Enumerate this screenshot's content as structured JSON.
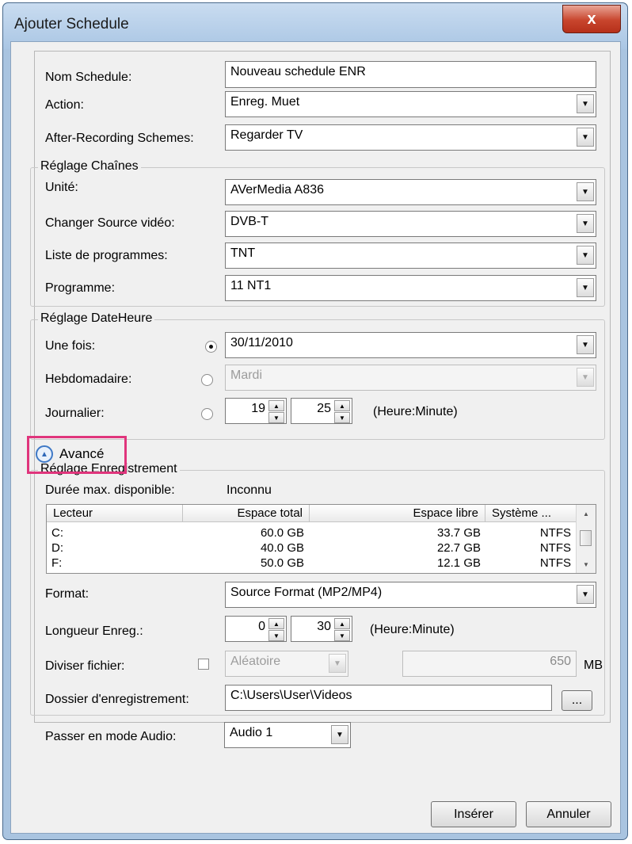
{
  "window": {
    "title": "Ajouter Schedule",
    "close_label": "x"
  },
  "top": {
    "name_label": "Nom Schedule:",
    "name_value": "Nouveau schedule ENR",
    "action_label": "Action:",
    "action_value": "Enreg. Muet",
    "after_label": "After-Recording Schemes:",
    "after_value": "Regarder TV"
  },
  "channels": {
    "legend": "Réglage Chaînes",
    "unit_label": "Unité:",
    "unit_value": "AVerMedia A836",
    "source_label": "Changer Source vidéo:",
    "source_value": "DVB-T",
    "list_label": "Liste de programmes:",
    "list_value": "TNT",
    "program_label": "Programme:",
    "program_value": "11 NT1"
  },
  "datetime": {
    "legend": "Réglage DateHeure",
    "once_label": "Une fois:",
    "once_value": "30/11/2010",
    "once_checked": true,
    "weekly_label": "Hebdomadaire:",
    "weekly_value": "Mardi",
    "daily_label": "Journalier:",
    "daily_hour": "19",
    "daily_minute": "25",
    "daily_hint": "(Heure:Minute)"
  },
  "advanced": {
    "toggle_label": "Avancé"
  },
  "recording": {
    "legend": "Réglage Enregistrement",
    "maxdur_label": "Durée max. disponible:",
    "maxdur_value": "Inconnu",
    "columns": [
      "Lecteur",
      "Espace total",
      "Espace libre",
      "Système ..."
    ],
    "rows": [
      [
        "C:",
        "60.0 GB",
        "33.7 GB",
        "NTFS"
      ],
      [
        "D:",
        "40.0 GB",
        "22.7 GB",
        "NTFS"
      ],
      [
        "F:",
        "50.0 GB",
        "12.1 GB",
        "NTFS"
      ]
    ],
    "format_label": "Format:",
    "format_value": "Source Format (MP2/MP4)",
    "length_label": "Longueur Enreg.:",
    "length_hour": "0",
    "length_minute": "30",
    "length_hint": "(Heure:Minute)",
    "split_label": "Diviser fichier:",
    "split_mode": "Aléatoire",
    "split_size": "650",
    "split_unit": "MB",
    "folder_label": "Dossier d'enregistrement:",
    "folder_value": "C:\\Users\\User\\Videos",
    "browse_label": "...",
    "audio_label": "Passer en mode Audio:",
    "audio_value": "Audio 1"
  },
  "buttons": {
    "insert": "Insérer",
    "cancel": "Annuler"
  }
}
